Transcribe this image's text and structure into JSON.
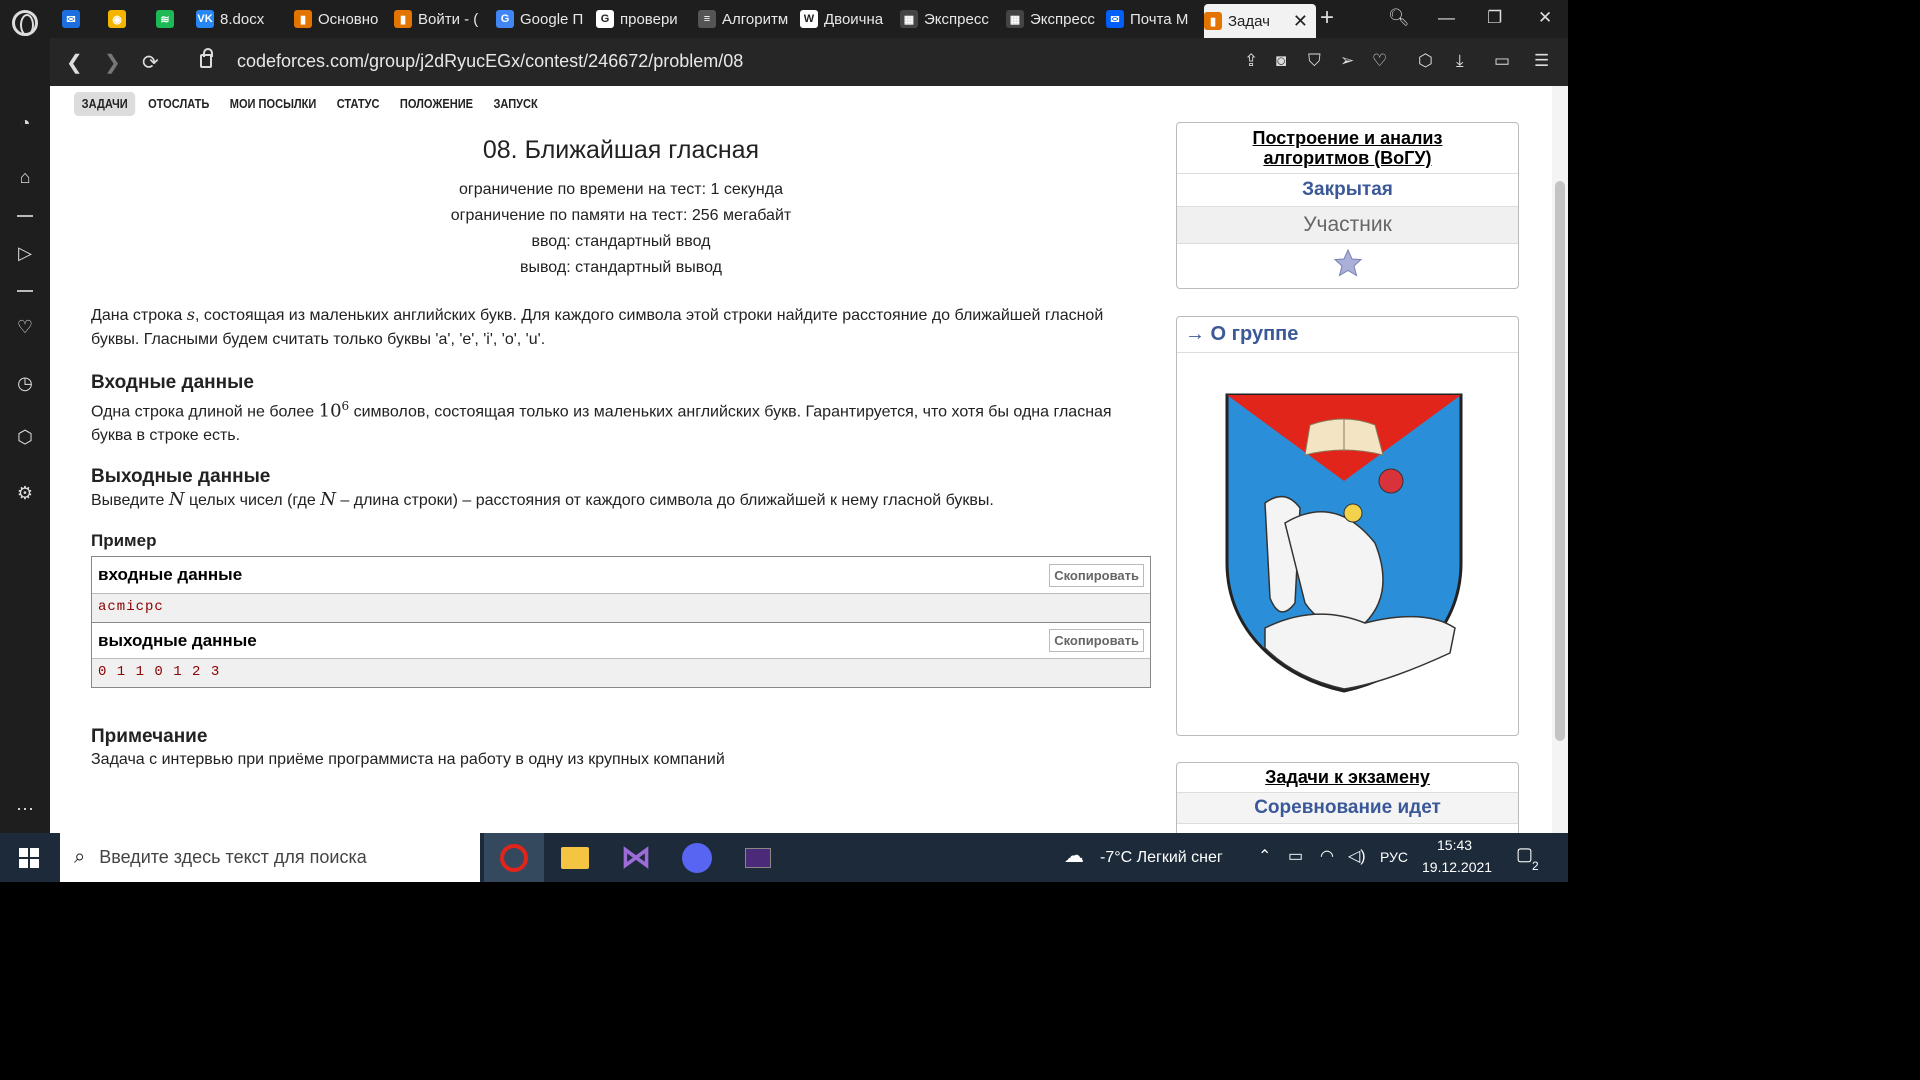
{
  "browser": {
    "tabs": [
      {
        "label": "",
        "color": "#1d6fe0",
        "glyph": "✉",
        "icon": "messenger-icon"
      },
      {
        "label": "",
        "color": "#f4b400",
        "glyph": "◉",
        "icon": "notes-icon"
      },
      {
        "label": "",
        "color": "#1db954",
        "glyph": "≋",
        "icon": "spotify-icon"
      },
      {
        "label": "8.docx",
        "color": "#2787f5",
        "glyph": "VK",
        "icon": "vk-icon"
      },
      {
        "label": "Основно",
        "color": "#e37400",
        "glyph": "▮",
        "icon": "analytics-icon"
      },
      {
        "label": "Войти - (",
        "color": "#e37400",
        "glyph": "▮",
        "icon": "analytics-icon"
      },
      {
        "label": "Google П",
        "color": "#4285f4",
        "glyph": "G",
        "icon": "translate-icon"
      },
      {
        "label": "провери",
        "color": "#ffffff",
        "glyph": "G",
        "icon": "google-icon"
      },
      {
        "label": "Алгоритм",
        "color": "#555555",
        "glyph": "≡",
        "icon": "book-icon"
      },
      {
        "label": "Двоична",
        "color": "#ffffff",
        "glyph": "W",
        "icon": "wikipedia-icon"
      },
      {
        "label": "Экспресс",
        "color": "#444444",
        "glyph": "▦",
        "icon": "speed-dial-icon"
      },
      {
        "label": "Экспресс",
        "color": "#444444",
        "glyph": "▦",
        "icon": "speed-dial-icon"
      },
      {
        "label": "Почта М",
        "color": "#005ff9",
        "glyph": "✉",
        "icon": "mail-icon"
      },
      {
        "label": "Задач",
        "color": "#e37400",
        "glyph": "▮",
        "icon": "codeforces-icon"
      }
    ],
    "url": "codeforces.com/group/j2dRyucEGx/contest/246672/problem/08"
  },
  "submenu": [
    "ЗАДАЧИ",
    "ОТОСЛАТЬ",
    "МОИ ПОСЫЛКИ",
    "СТАТУС",
    "ПОЛОЖЕНИЕ",
    "ЗАПУСК"
  ],
  "problem": {
    "title": "08. Ближайшая гласная",
    "time_limit": "ограничение по времени на тест: 1 секунда",
    "memory_limit": "ограничение по памяти на тест: 256 мегабайт",
    "input": "ввод: стандартный ввод",
    "output": "вывод: стандартный вывод",
    "statement_a": "Дана строка ",
    "statement_var": "s",
    "statement_b": ", состоящая из маленьких английских букв. Для каждого символа этой строки найдите расстояние до ближайшей гласной буквы. Гласными будем считать только буквы 'a', 'e', 'i', 'o', 'u'.",
    "input_title": "Входные данные",
    "input_a": "Одна строка длиной не более ",
    "input_base": "10",
    "input_exp": "6",
    "input_b": " символов, состоящая только из маленьких английских букв. Гарантируется, что хотя бы одна гласная буква в строке есть.",
    "output_title": "Выходные данные",
    "output_a": "Выведите ",
    "output_var": "N",
    "output_b": " целых чисел (где ",
    "output_var2": "N",
    "output_c": " – длина строки) – расстояния от каждого символа до ближайшей к нему гласной буквы.",
    "example_title": "Пример",
    "sample_input_label": "входные  данные",
    "sample_input": "acmicpc",
    "sample_output_label": "выходные  данные",
    "sample_output": "0 1 1 0 1 2 3",
    "copy_label": "Скопировать",
    "note_title": "Примечание",
    "note_text": "Задача с интервью при приёме программиста на работу в одну из крупных компаний"
  },
  "right": {
    "contest_name": "Построение и анализ алгоритмов (ВоГУ)",
    "contest_status": "Закрытая",
    "role": "Участник",
    "group_link": "→ О группе",
    "exam_title": "Задачи к экзамену",
    "exam_status": "Соревнование идет"
  },
  "taskbar": {
    "search_placeholder": "Введите здесь текст для поиска",
    "weather": "-7°C  Легкий снег",
    "lang": "РУС",
    "time": "15:43",
    "date": "19.12.2021",
    "notifications": "2"
  }
}
